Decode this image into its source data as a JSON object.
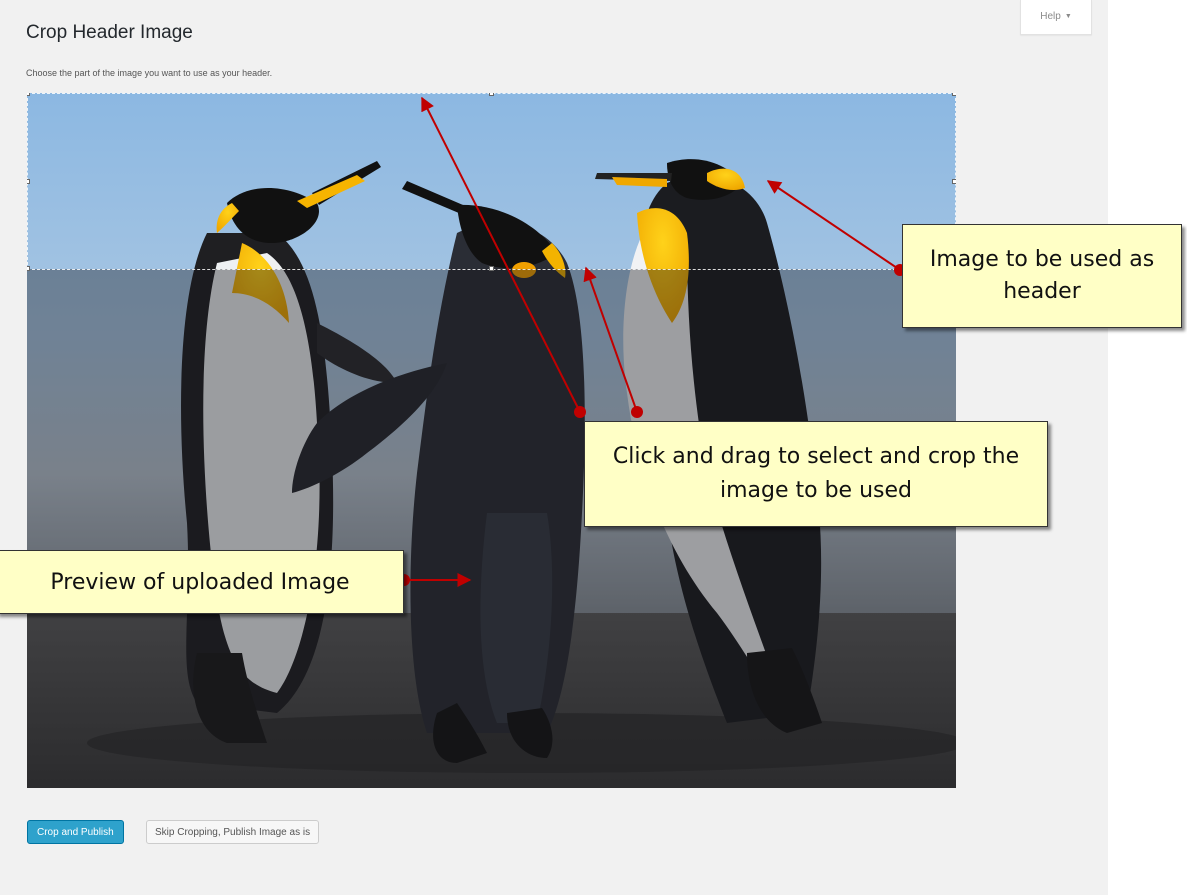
{
  "help_tab": {
    "label": "Help",
    "caret": "▼"
  },
  "page": {
    "title": "Crop Header Image",
    "description": "Choose the part of the image you want to use as your header."
  },
  "image": {
    "subject": "penguins-photo",
    "crop_icon": "crop-selection"
  },
  "buttons": {
    "crop_publish": "Crop and Publish",
    "skip_cropping": "Skip Cropping, Publish Image as is"
  },
  "annotations": {
    "header_label": "Image to be used as header",
    "crop_label": "Click and drag to select and crop the image to be used",
    "preview_label": "Preview of uploaded Image"
  },
  "colors": {
    "primary_button": "#2ea2cc",
    "callout_bg": "#ffffc6",
    "arrow": "#c00000",
    "panel_bg": "#f1f1f1"
  }
}
